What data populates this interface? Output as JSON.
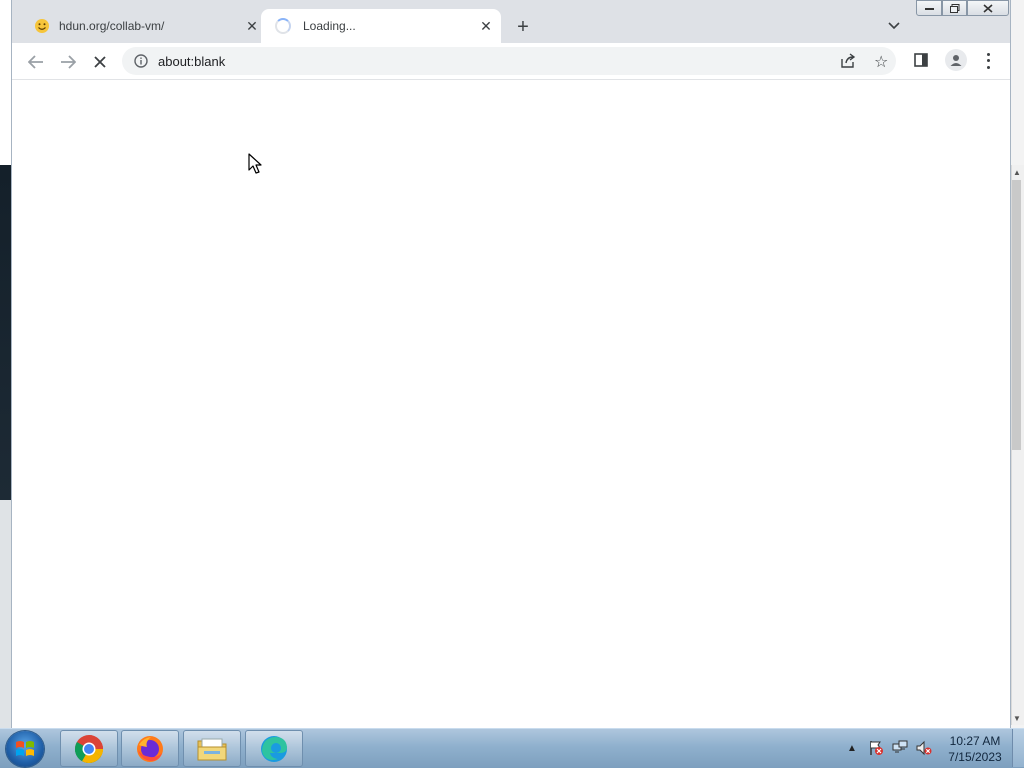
{
  "browser": {
    "tabs": [
      {
        "title": "hdun.org/collab-vm/",
        "favicon": "smiley-favicon",
        "active": false
      },
      {
        "title": "Loading...",
        "favicon": "loading-spinner",
        "active": true
      }
    ],
    "new_tab_label": "+",
    "address_bar": {
      "url": "about:blank",
      "icon": "info-icon"
    },
    "toolbar_icons": [
      "back-icon",
      "forward-icon",
      "stop-icon",
      "share-icon",
      "star-icon",
      "side-panel-icon",
      "profile-icon",
      "menu-icon"
    ],
    "accent_color": "#8ab4f8"
  },
  "taskbar": {
    "apps": [
      "Google Chrome",
      "Firefox",
      "Windows Explorer",
      "Microsoft Edge"
    ],
    "tray_icons": [
      "show-hidden-icons",
      "action-center-icon",
      "network-icon",
      "volume-muted-icon"
    ],
    "clock": {
      "time": "10:27 AM",
      "date": "7/15/2023"
    }
  }
}
